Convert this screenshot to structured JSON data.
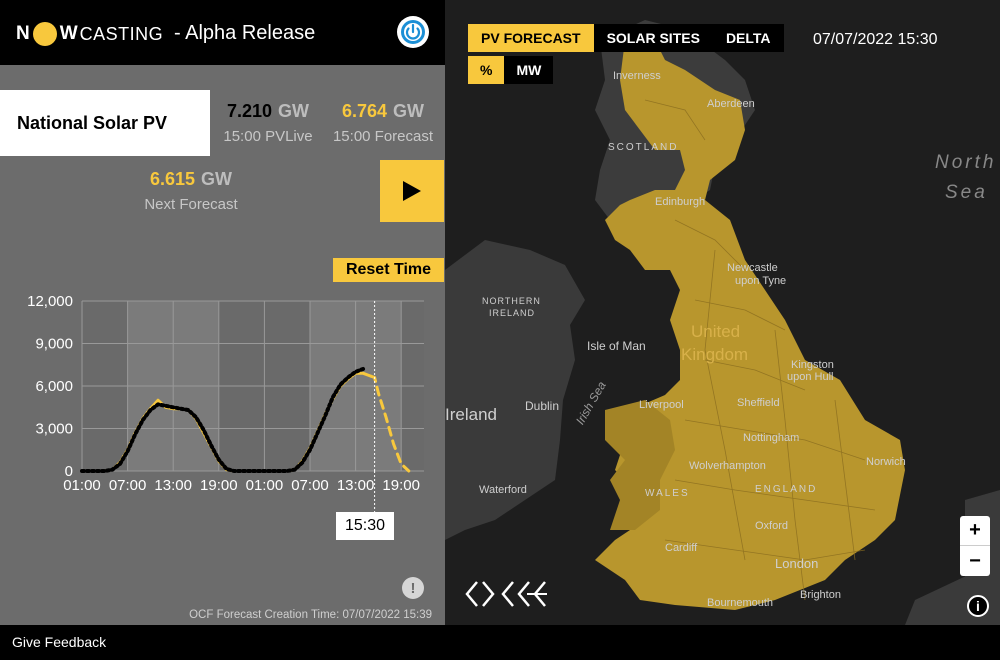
{
  "header": {
    "logo_n": "N",
    "logo_w": "W",
    "logo_casting": "CASTING",
    "release": "- Alpha Release"
  },
  "panel": {
    "title": "National Solar PV",
    "pvlive": {
      "value": "7.210",
      "unit": "GW",
      "caption": "15:00 PVLive"
    },
    "forecast": {
      "value": "6.764",
      "unit": "GW",
      "caption": "15:00 Forecast"
    },
    "next_forecast": {
      "value": "6.615",
      "unit": "GW",
      "caption": "Next Forecast"
    },
    "reset_label": "Reset Time",
    "selected_time": "15:30",
    "creation_time": "OCF Forecast Creation Time: 07/07/2022 15:39",
    "info_icon": "exclamation-icon"
  },
  "chart_data": {
    "type": "line",
    "x_ticks": [
      "01:00",
      "07:00",
      "13:00",
      "19:00",
      "01:00",
      "07:00",
      "13:00",
      "19:00"
    ],
    "y_ticks": [
      "12,000",
      "9,000",
      "6,000",
      "3,000",
      "0"
    ],
    "ylim": [
      0,
      12000
    ],
    "unit": "MW",
    "x_hours": [
      0,
      2,
      3,
      4,
      5,
      6,
      7,
      8,
      9,
      10,
      11,
      12,
      13,
      14,
      15,
      16,
      17,
      18,
      19,
      20,
      21,
      22,
      23,
      24,
      26,
      27,
      28,
      29,
      30,
      31,
      32,
      33,
      34,
      35,
      36,
      37,
      38,
      38.5,
      39,
      40,
      41,
      42,
      43
    ],
    "series": [
      {
        "style": "solid",
        "color": "#f8c83d",
        "values": [
          0,
          0,
          0,
          100,
          600,
          1500,
          2700,
          3700,
          4400,
          5000,
          4500,
          4400,
          4400,
          4300,
          3700,
          2700,
          1700,
          700,
          100,
          0,
          0,
          0,
          0,
          0,
          0,
          0,
          100,
          700,
          1600,
          2800,
          4000,
          5100,
          6000,
          6500,
          6900,
          6900,
          6700,
          null,
          null,
          null,
          null,
          null,
          null
        ]
      },
      {
        "style": "dotted",
        "color": "#000000",
        "values": [
          0,
          0,
          0,
          100,
          500,
          1400,
          2600,
          3600,
          4300,
          4700,
          4600,
          4500,
          4400,
          4300,
          3800,
          2900,
          1800,
          800,
          150,
          0,
          0,
          0,
          0,
          0,
          0,
          0,
          100,
          600,
          1500,
          2700,
          3900,
          5200,
          6100,
          6600,
          7000,
          7210,
          null,
          null,
          null,
          null,
          null,
          null,
          null
        ]
      },
      {
        "style": "dashed",
        "color": "#f8c83d",
        "values": [
          null,
          null,
          null,
          null,
          null,
          null,
          null,
          null,
          null,
          null,
          null,
          null,
          null,
          null,
          null,
          null,
          null,
          null,
          null,
          null,
          null,
          null,
          null,
          null,
          null,
          null,
          null,
          null,
          null,
          null,
          null,
          null,
          null,
          null,
          null,
          null,
          6700,
          6600,
          5500,
          3800,
          1900,
          500,
          0
        ]
      }
    ]
  },
  "map": {
    "tabs": [
      "PV FORECAST",
      "SOLAR SITES",
      "DELTA"
    ],
    "active_tab": "PV FORECAST",
    "unit_tabs": [
      "%",
      "MW"
    ],
    "active_unit": "%",
    "datetime": "07/07/2022 15:30",
    "labels": [
      {
        "text": "Inverness"
      },
      {
        "text": "Aberdeen"
      },
      {
        "text": "SCOTLAND"
      },
      {
        "text": "Edinburgh"
      },
      {
        "text": "Newcastle"
      },
      {
        "text": "upon Tyne"
      },
      {
        "text": "NORTHERN"
      },
      {
        "text": "IRELAND"
      },
      {
        "text": "Isle of Man"
      },
      {
        "text": "United"
      },
      {
        "text": "Kingdom"
      },
      {
        "text": "Kingston"
      },
      {
        "text": "upon Hull"
      },
      {
        "text": "Dublin"
      },
      {
        "text": "Ireland"
      },
      {
        "text": "Liverpool"
      },
      {
        "text": "Sheffield"
      },
      {
        "text": "Nottingham"
      },
      {
        "text": "Wolverhampton"
      },
      {
        "text": "Norwich"
      },
      {
        "text": "ENGLAND"
      },
      {
        "text": "WALES"
      },
      {
        "text": "Oxford"
      },
      {
        "text": "Cardiff"
      },
      {
        "text": "London"
      },
      {
        "text": "Brighton"
      },
      {
        "text": "Bournemouth"
      },
      {
        "text": "Waterford"
      },
      {
        "text": "North"
      },
      {
        "text": "Sea"
      },
      {
        "text": "Irish Sea"
      }
    ],
    "zoom_in": "+",
    "zoom_out": "−",
    "info": "i"
  },
  "footer": {
    "feedback": "Give Feedback"
  }
}
